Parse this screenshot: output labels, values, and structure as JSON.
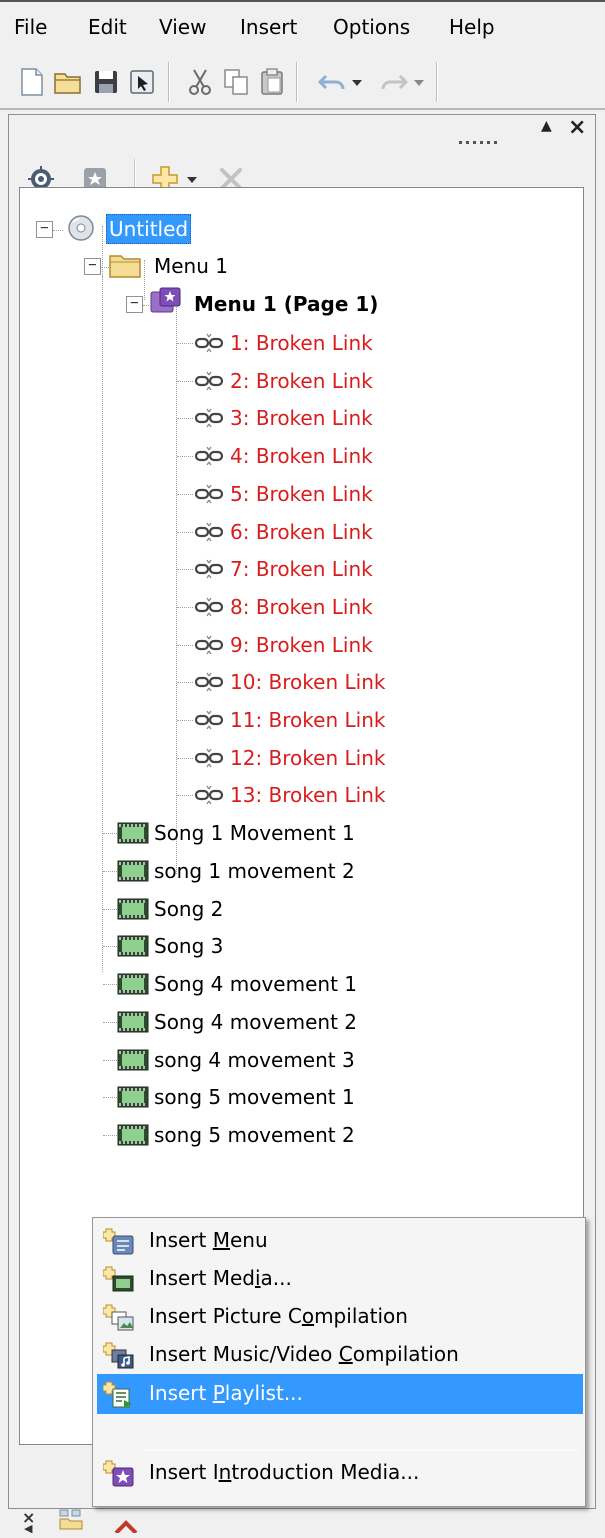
{
  "menubar": {
    "items": [
      {
        "label": "File"
      },
      {
        "label": "Edit"
      },
      {
        "label": "View"
      },
      {
        "label": "Insert"
      },
      {
        "label": "Options"
      },
      {
        "label": "Help"
      }
    ]
  },
  "toolbar": {
    "buttons": [
      "new-icon",
      "open-folder-icon",
      "save-icon",
      "export-icon",
      "cut-icon",
      "copy-icon",
      "paste-icon",
      "undo-icon",
      "undo-dropdown-icon",
      "redo-icon",
      "redo-dropdown-icon"
    ]
  },
  "panel": {
    "toolbar_buttons": [
      "target-icon",
      "star-icon",
      "add-icon",
      "add-dropdown-icon",
      "delete-icon"
    ]
  },
  "tree": {
    "root": {
      "label": "Untitled",
      "icon": "disc-icon"
    },
    "menu_folder": {
      "label": "Menu 1",
      "icon": "folder-icon"
    },
    "menu_page": {
      "label": "Menu 1 (Page 1)",
      "icon": "menu-page-icon"
    },
    "links": [
      {
        "label": "1: Broken Link"
      },
      {
        "label": "2: Broken Link"
      },
      {
        "label": "3: Broken Link"
      },
      {
        "label": "4: Broken Link"
      },
      {
        "label": "5: Broken Link"
      },
      {
        "label": "6: Broken Link"
      },
      {
        "label": "7: Broken Link"
      },
      {
        "label": "8: Broken Link"
      },
      {
        "label": "9: Broken Link"
      },
      {
        "label": "10: Broken Link"
      },
      {
        "label": "11: Broken Link"
      },
      {
        "label": "12: Broken Link"
      },
      {
        "label": "13: Broken Link"
      }
    ],
    "media": [
      {
        "label": "Song 1 Movement 1"
      },
      {
        "label": "song 1 movement 2"
      },
      {
        "label": "Song 2"
      },
      {
        "label": "Song 3"
      },
      {
        "label": "Song 4 movement 1"
      },
      {
        "label": "Song 4 movement 2"
      },
      {
        "label": "song 4 movement 3"
      },
      {
        "label": "song 5 movement 1"
      },
      {
        "label": "song 5 movement 2"
      }
    ]
  },
  "context_menu": {
    "items": [
      {
        "pre": "Insert ",
        "key": "M",
        "post": "enu",
        "icon": "insert-menu-icon"
      },
      {
        "pre": "Insert Med",
        "key": "i",
        "post": "a...",
        "icon": "insert-media-icon"
      },
      {
        "pre": "Insert Picture C",
        "key": "o",
        "post": "mpilation",
        "icon": "insert-picture-compilation-icon"
      },
      {
        "pre": "Insert Music/Video ",
        "key": "C",
        "post": "ompilation",
        "icon": "insert-music-video-compilation-icon"
      },
      {
        "pre": "Insert ",
        "key": "P",
        "post": "laylist...",
        "icon": "insert-playlist-icon",
        "highlighted": true
      },
      {
        "pre": "Insert I",
        "key": "n",
        "post": "troduction Media...",
        "icon": "insert-introduction-media-icon"
      }
    ]
  },
  "colors": {
    "broken_link": "#d91d1d",
    "selection": "#3399ff"
  }
}
